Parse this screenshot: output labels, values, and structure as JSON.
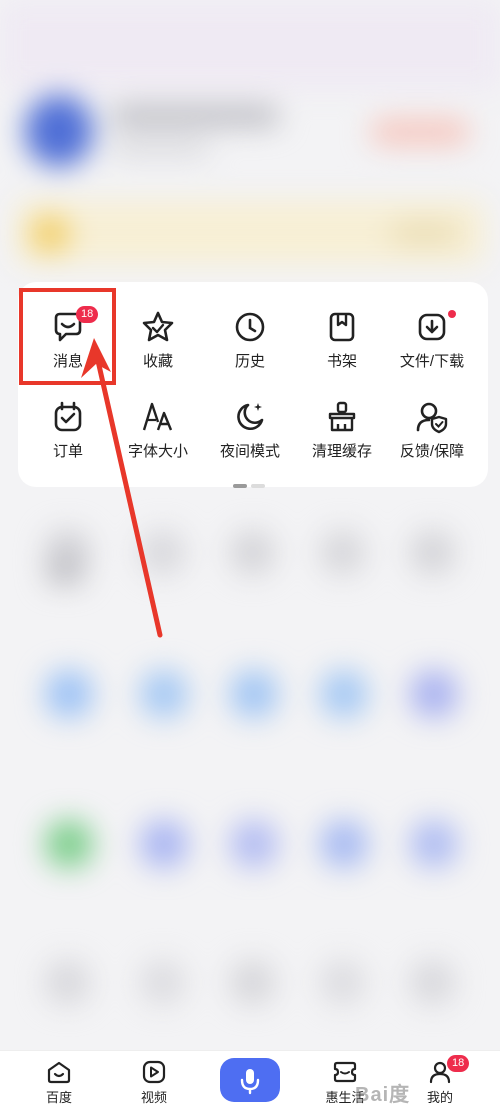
{
  "quick_actions": {
    "row1": [
      {
        "label": "消息",
        "icon": "message-icon",
        "badge": "18"
      },
      {
        "label": "收藏",
        "icon": "star-icon"
      },
      {
        "label": "历史",
        "icon": "clock-icon"
      },
      {
        "label": "书架",
        "icon": "bookshelf-icon"
      },
      {
        "label": "文件/下载",
        "icon": "download-icon",
        "dot": true
      }
    ],
    "row2": [
      {
        "label": "订单",
        "icon": "order-icon"
      },
      {
        "label": "字体大小",
        "icon": "font-size-icon"
      },
      {
        "label": "夜间模式",
        "icon": "moon-icon"
      },
      {
        "label": "清理缓存",
        "icon": "broom-icon"
      },
      {
        "label": "反馈/保障",
        "icon": "feedback-shield-icon"
      }
    ]
  },
  "bottom_nav": {
    "home": "百度",
    "video": "视频",
    "life": "惠生活",
    "mine": "我的",
    "mine_badge": "18"
  },
  "watermark": "Bai度",
  "colors": {
    "accent": "#4e6ef2",
    "badge": "#ee2c4c",
    "annotation": "#e8372a"
  }
}
